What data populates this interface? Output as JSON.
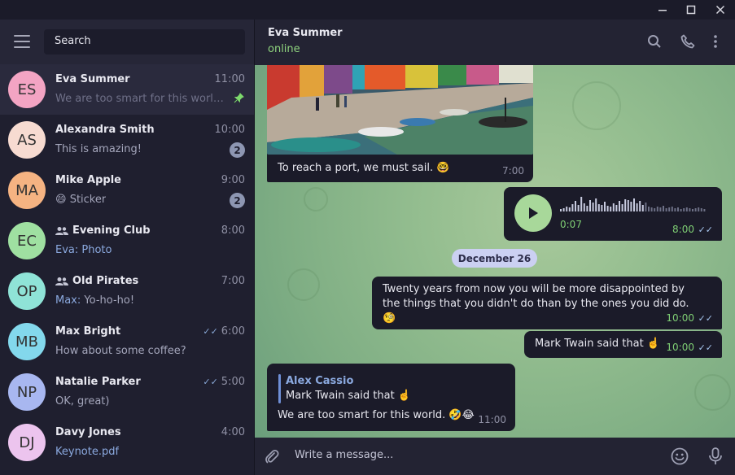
{
  "titlebar": {
    "icons": [
      "minimize-icon",
      "maximize-icon",
      "close-icon"
    ]
  },
  "sidebar": {
    "search_placeholder": "Search",
    "chats": [
      {
        "initials": "ES",
        "avatar_color": "#f3a4c3",
        "name": "Eva Summer",
        "time": "11:00",
        "preview": "We are too smart for this world. 🤣😂",
        "pinned": true,
        "active": true
      },
      {
        "initials": "AS",
        "avatar_color": "#f7dbd1",
        "name": "Alexandra Smith",
        "time": "10:00",
        "preview": "This is amazing!",
        "unread": "2"
      },
      {
        "initials": "MA",
        "avatar_color": "#f5b382",
        "name": "Mike Apple",
        "time": "9:00",
        "preview_emoji": "😄",
        "preview": "Sticker",
        "unread": "2"
      },
      {
        "initials": "EC",
        "avatar_color": "#9fe0a1",
        "name": "Evening Club",
        "group": true,
        "time": "8:00",
        "preview_accent": "Eva: Photo"
      },
      {
        "initials": "OP",
        "avatar_color": "#8fe3d7",
        "name": "Old Pirates",
        "group": true,
        "time": "7:00",
        "preview_sender": "Max:",
        "preview": "Yo-ho-ho!"
      },
      {
        "initials": "MB",
        "avatar_color": "#83d8ec",
        "name": "Max Bright",
        "time": "6:00",
        "read": true,
        "preview": "How about some coffee?"
      },
      {
        "initials": "NP",
        "avatar_color": "#a8b7f0",
        "name": "Natalie Parker",
        "time": "5:00",
        "read": true,
        "preview": "OK, great)"
      },
      {
        "initials": "DJ",
        "avatar_color": "#ecc4ee",
        "name": "Davy Jones",
        "time": "4:00",
        "preview_accent": "Keynote.pdf"
      }
    ]
  },
  "header": {
    "peer_name": "Eva Summer",
    "peer_status": "online",
    "icons": [
      "search-icon",
      "phone-icon",
      "more-icon"
    ]
  },
  "messages": {
    "photo_caption": "To reach a port, we must sail. 🤓",
    "photo_time": "7:00",
    "voice_duration": "0:07",
    "voice_time": "8:00",
    "date_separator": "December 26",
    "msg1_text": "Twenty years from now you will be more disappointed by the things that you didn't do than by the ones you did do. 🧐",
    "msg1_time": "10:00",
    "msg2_text": "Mark Twain said that ☝️",
    "msg2_time": "10:00",
    "reply_author": "Alex Cassio",
    "reply_quote": "Mark Twain said that ☝️",
    "msg3_text": "We are too smart for this world. 🤣😂",
    "msg3_time": "11:00"
  },
  "composer": {
    "placeholder": "Write a message...",
    "icons": [
      "attach-icon",
      "emoji-icon",
      "microphone-icon"
    ]
  },
  "colors": {
    "accent": "#8fd47e",
    "bubble": "#1b1b29",
    "sidebar": "#1f1f2f",
    "unread_badge": "#8d96b2"
  }
}
